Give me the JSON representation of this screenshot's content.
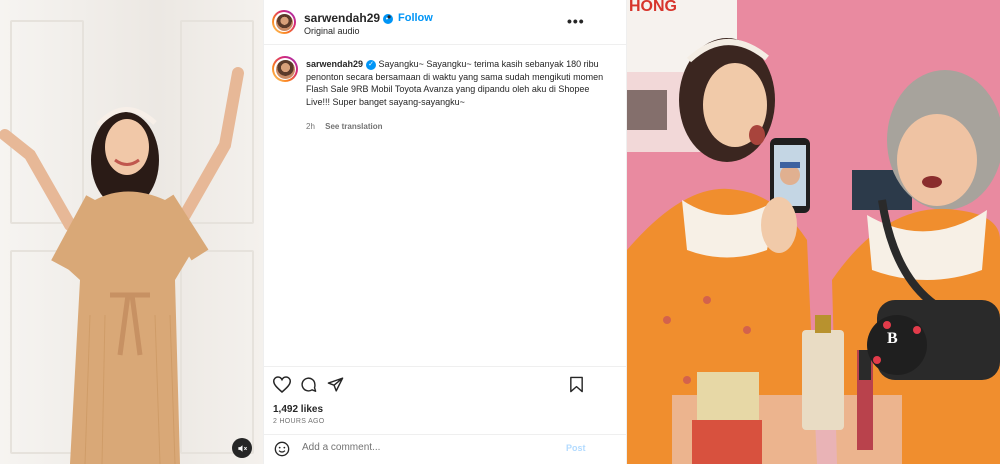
{
  "post": {
    "username": "sarwendah29",
    "separator": "•",
    "follow_label": "Follow",
    "audio": "Original audio",
    "more_label": "•••",
    "verified_glyph": "✓",
    "caption": {
      "username": "sarwendah29",
      "text": "Sayangku~ Sayangku~ terima kasih sebanyak 180 ribu penonton secara bersamaan di waktu yang sama sudah mengikuti momen Flash Sale 9RB Mobil Toyota Avanza yang dipandu oleh aku di Shopee Live!!! Super banget sayang-sayangku~",
      "time": "2h",
      "translation_label": "See translation"
    },
    "likes": "1,492 likes",
    "time_ago": "2 HOURS AGO",
    "comment_placeholder": "Add a comment...",
    "post_label": "Post"
  },
  "media_right": {
    "sign_text": "HONG",
    "badge_letter": "B"
  },
  "icons": {
    "like": "heart-icon",
    "comment": "comment-icon",
    "share": "send-icon",
    "save": "bookmark-icon",
    "emoji": "emoji-icon",
    "mute": "mute-icon",
    "verified": "verified-icon"
  },
  "colors": {
    "link": "#0095f6",
    "post_disabled": "#b3dbff",
    "text": "#262626",
    "muted": "#737373"
  }
}
